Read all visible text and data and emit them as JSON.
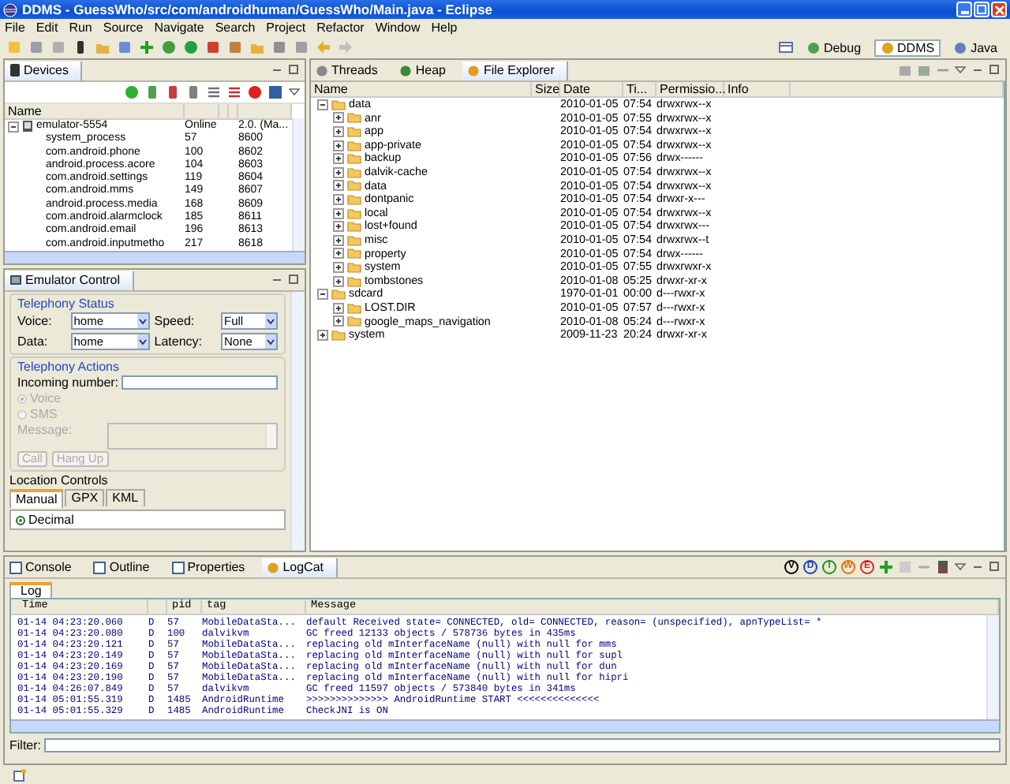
{
  "window": {
    "title": "DDMS - GuessWho/src/com/androidhuman/GuessWho/Main.java - Eclipse"
  },
  "menu": [
    "File",
    "Edit",
    "Run",
    "Source",
    "Navigate",
    "Search",
    "Project",
    "Refactor",
    "Window",
    "Help"
  ],
  "perspectives": [
    {
      "label": "Debug",
      "selected": false
    },
    {
      "label": "DDMS",
      "selected": true
    },
    {
      "label": "Java",
      "selected": false
    }
  ],
  "devices": {
    "title": "Devices",
    "columns": [
      "Name"
    ],
    "rows": [
      {
        "name": "emulator-5554",
        "value": "Online",
        "info": "2.0. (Ma...",
        "expanded": true,
        "children": [
          {
            "name": "system_process",
            "value": "57",
            "info": "8600"
          },
          {
            "name": "com.android.phone",
            "value": "100",
            "info": "8602"
          },
          {
            "name": "android.process.acore",
            "value": "104",
            "info": "8603"
          },
          {
            "name": "com.android.settings",
            "value": "119",
            "info": "8604"
          },
          {
            "name": "com.android.mms",
            "value": "149",
            "info": "8607"
          },
          {
            "name": "android.process.media",
            "value": "168",
            "info": "8609"
          },
          {
            "name": "com.android.alarmclock",
            "value": "185",
            "info": "8611"
          },
          {
            "name": "com.android.email",
            "value": "196",
            "info": "8613"
          },
          {
            "name": "com.android.inputmetho",
            "value": "217",
            "info": "8618"
          }
        ]
      }
    ]
  },
  "emulator_control": {
    "title": "Emulator Control",
    "telephony_status": {
      "title": "Telephony Status",
      "fields": [
        {
          "label": "Voice:",
          "value": "home"
        },
        {
          "label": "Speed:",
          "value": "Full"
        },
        {
          "label": "Data:",
          "value": "home"
        },
        {
          "label": "Latency:",
          "value": "None"
        }
      ]
    },
    "telephony_actions": {
      "title": "Telephony Actions",
      "incoming_label": "Incoming number:",
      "radios": [
        {
          "label": "Voice",
          "selected": true,
          "disabled": true
        },
        {
          "label": "SMS",
          "selected": false,
          "disabled": true
        }
      ],
      "message_label": "Message:",
      "buttons": [
        {
          "label": "Call",
          "disabled": true
        },
        {
          "label": "Hang Up",
          "disabled": true
        }
      ]
    },
    "location_controls": {
      "title": "Location Controls",
      "tabs": [
        {
          "label": "Manual",
          "selected": true
        },
        {
          "label": "GPX",
          "selected": false
        },
        {
          "label": "KML",
          "selected": false
        }
      ],
      "radio": {
        "label": "Decimal",
        "selected": true
      }
    }
  },
  "file_explorer": {
    "tabs": [
      {
        "label": "Threads",
        "selected": false
      },
      {
        "label": "Heap",
        "selected": false
      },
      {
        "label": "File Explorer",
        "selected": true
      }
    ],
    "columns": [
      "Name",
      "Size",
      "Date",
      "Ti...",
      "Permissio...",
      "Info"
    ],
    "rows": [
      {
        "name": "data",
        "date": "2010-01-05",
        "time": "07:54",
        "permissions": "drwxrwx--x",
        "expanded": true,
        "children": [
          {
            "name": "anr",
            "date": "2010-01-05",
            "time": "07:55",
            "permissions": "drwxrwx--x",
            "expanded": false
          },
          {
            "name": "app",
            "date": "2010-01-05",
            "time": "07:54",
            "permissions": "drwxrwx--x",
            "expanded": false
          },
          {
            "name": "app-private",
            "date": "2010-01-05",
            "time": "07:54",
            "permissions": "drwxrwx--x",
            "expanded": false
          },
          {
            "name": "backup",
            "date": "2010-01-05",
            "time": "07:56",
            "permissions": "drwx------",
            "expanded": false
          },
          {
            "name": "dalvik-cache",
            "date": "2010-01-05",
            "time": "07:54",
            "permissions": "drwxrwx--x",
            "expanded": false
          },
          {
            "name": "data",
            "date": "2010-01-05",
            "time": "07:54",
            "permissions": "drwxrwx--x",
            "expanded": false
          },
          {
            "name": "dontpanic",
            "date": "2010-01-05",
            "time": "07:54",
            "permissions": "drwxr-x---",
            "expanded": false
          },
          {
            "name": "local",
            "date": "2010-01-05",
            "time": "07:54",
            "permissions": "drwxrwx--x",
            "expanded": false
          },
          {
            "name": "lost+found",
            "date": "2010-01-05",
            "time": "07:54",
            "permissions": "drwxrwx---",
            "expanded": false
          },
          {
            "name": "misc",
            "date": "2010-01-05",
            "time": "07:54",
            "permissions": "drwxrwx--t",
            "expanded": false
          },
          {
            "name": "property",
            "date": "2010-01-05",
            "time": "07:54",
            "permissions": "drwx------",
            "expanded": false
          },
          {
            "name": "system",
            "date": "2010-01-05",
            "time": "07:55",
            "permissions": "drwxrwxr-x",
            "expanded": false
          },
          {
            "name": "tombstones",
            "date": "2010-01-08",
            "time": "05:25",
            "permissions": "drwxr-xr-x",
            "expanded": false
          }
        ]
      },
      {
        "name": "sdcard",
        "date": "1970-01-01",
        "time": "00:00",
        "permissions": "d---rwxr-x",
        "expanded": true,
        "children": [
          {
            "name": "LOST.DIR",
            "date": "2010-01-05",
            "time": "07:57",
            "permissions": "d---rwxr-x",
            "expanded": false
          },
          {
            "name": "google_maps_navigation",
            "date": "2010-01-08",
            "time": "05:24",
            "permissions": "d---rwxr-x",
            "expanded": false
          }
        ]
      },
      {
        "name": "system",
        "date": "2009-11-23",
        "time": "20:24",
        "permissions": "drwxr-xr-x",
        "expanded": false
      }
    ]
  },
  "bottom_panel": {
    "tabs": [
      {
        "label": "Console",
        "selected": false
      },
      {
        "label": "Outline",
        "selected": false
      },
      {
        "label": "Properties",
        "selected": false
      },
      {
        "label": "LogCat",
        "selected": true
      }
    ],
    "log_filters": [
      {
        "label": "V",
        "color": "#000000"
      },
      {
        "label": "D",
        "color": "#1f3fbf"
      },
      {
        "label": "I",
        "color": "#1f8f1f"
      },
      {
        "label": "W",
        "color": "#e07000"
      },
      {
        "label": "E",
        "color": "#e02020"
      }
    ],
    "log_tab": "Log",
    "columns": [
      "Time",
      "",
      "pid",
      "tag",
      "Message"
    ],
    "rows": [
      {
        "time": "01-14 04:23:20.060",
        "priority": "D",
        "pid": "57",
        "tag": "MobileDataSta...",
        "message": "default Received state= CONNECTED, old= CONNECTED, reason= (unspecified), apnTypeList= *"
      },
      {
        "time": "01-14 04:23:20.080",
        "priority": "D",
        "pid": "100",
        "tag": "dalvikvm",
        "message": "GC freed 12133 objects / 578736 bytes in 435ms"
      },
      {
        "time": "01-14 04:23:20.121",
        "priority": "D",
        "pid": "57",
        "tag": "MobileDataSta...",
        "message": "replacing old mInterfaceName (null) with null for mms"
      },
      {
        "time": "01-14 04:23:20.149",
        "priority": "D",
        "pid": "57",
        "tag": "MobileDataSta...",
        "message": "replacing old mInterfaceName (null) with null for supl"
      },
      {
        "time": "01-14 04:23:20.169",
        "priority": "D",
        "pid": "57",
        "tag": "MobileDataSta...",
        "message": "replacing old mInterfaceName (null) with null for dun"
      },
      {
        "time": "01-14 04:23:20.190",
        "priority": "D",
        "pid": "57",
        "tag": "MobileDataSta...",
        "message": "replacing old mInterfaceName (null) with null for hipri"
      },
      {
        "time": "01-14 04:26:07.849",
        "priority": "D",
        "pid": "57",
        "tag": "dalvikvm",
        "message": "GC freed 11597 objects / 573840 bytes in 341ms"
      },
      {
        "time": "01-14 05:01:55.319",
        "priority": "D",
        "pid": "1485",
        "tag": "AndroidRuntime",
        "message": ">>>>>>>>>>>>>> AndroidRuntime START <<<<<<<<<<<<<<"
      },
      {
        "time": "01-14 05:01:55.329",
        "priority": "D",
        "pid": "1485",
        "tag": "AndroidRuntime",
        "message": "CheckJNI is ON"
      }
    ],
    "filter_label": "Filter:"
  }
}
